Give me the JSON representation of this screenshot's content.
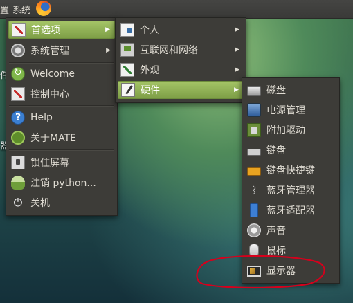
{
  "panel": {
    "left_fragment": "置",
    "system_menu_label": "系统",
    "launcher_icon": "firefox-icon"
  },
  "desktop_fragments": [
    "件",
    "器"
  ],
  "system_menu": {
    "items": [
      {
        "label": "首选项",
        "icon": "preferences-icon",
        "submenu": true,
        "active": true
      },
      {
        "label": "系统管理",
        "icon": "system-admin-icon",
        "submenu": true
      },
      {
        "label": "Welcome",
        "icon": "welcome-icon"
      },
      {
        "label": "控制中心",
        "icon": "control-center-icon"
      },
      {
        "label": "Help",
        "icon": "help-icon"
      },
      {
        "label": "关于MATE",
        "icon": "about-mate-icon"
      },
      {
        "label": "锁住屏幕",
        "icon": "lock-screen-icon"
      },
      {
        "label": "注销 python...",
        "icon": "logout-icon"
      },
      {
        "label": "关机",
        "icon": "power-icon"
      }
    ]
  },
  "preferences_menu": {
    "items": [
      {
        "label": "个人",
        "icon": "personal-icon",
        "submenu": true
      },
      {
        "label": "互联网和网络",
        "icon": "network-icon",
        "submenu": true
      },
      {
        "label": "外观",
        "icon": "appearance-icon",
        "submenu": true
      },
      {
        "label": "硬件",
        "icon": "hardware-icon",
        "submenu": true,
        "active": true
      }
    ]
  },
  "hardware_menu": {
    "items": [
      {
        "label": "磁盘",
        "icon": "disk-icon"
      },
      {
        "label": "电源管理",
        "icon": "power-management-icon"
      },
      {
        "label": "附加驱动",
        "icon": "additional-drivers-icon"
      },
      {
        "label": "键盘",
        "icon": "keyboard-icon"
      },
      {
        "label": "键盘快捷键",
        "icon": "keyboard-shortcuts-icon"
      },
      {
        "label": "蓝牙管理器",
        "icon": "bluetooth-icon"
      },
      {
        "label": "蓝牙适配器",
        "icon": "bluetooth-adapter-icon"
      },
      {
        "label": "声音",
        "icon": "sound-icon"
      },
      {
        "label": "鼠标",
        "icon": "mouse-icon"
      },
      {
        "label": "显示器",
        "icon": "display-icon",
        "circled": true
      }
    ]
  },
  "colors": {
    "menu_bg": "#3d3c38",
    "highlight": "#8fb356",
    "annotation_red": "#d6001c"
  }
}
